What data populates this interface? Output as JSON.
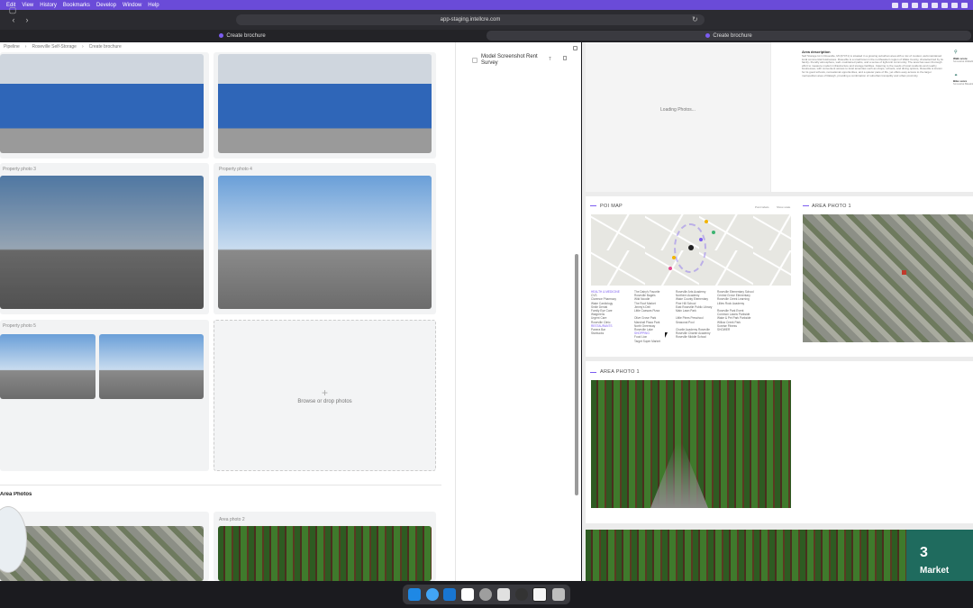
{
  "menubar": {
    "items": [
      "Edit",
      "View",
      "History",
      "Bookmarks",
      "Develop",
      "Window",
      "Help"
    ]
  },
  "browser": {
    "url": "app-staging.intellcre.com",
    "tabs": [
      {
        "label": "Create brochure",
        "active": false
      },
      {
        "label": "Create brochure",
        "active": true
      }
    ]
  },
  "breadcrumb": [
    "Pipeline",
    "Roseville Self-Storage",
    "Create brochure"
  ],
  "photos": {
    "property_photo_3_label": "Property photo 3",
    "property_photo_4_label": "Property photo 4",
    "property_photo_5_label": "Property photo 5",
    "dropzone_label": "Browse or drop photos",
    "area_section_title": "Area Photos",
    "area_photo_2_label": "Area photo 2"
  },
  "survey": {
    "title": "Model Screenshot Rent Survey",
    "sort_icon_label": "T"
  },
  "preview": {
    "loading_text": "Loading Photos...",
    "area_description_title": "Area description",
    "area_description_text": "Self Storage lot in Roseville, MI (07471) is situated in a growing suburban area with a mix of modest, well-maintained local commercial businesses. Roseville is a small town in the northeastern region of Wake County, characterized by its family- friendly atmosphere, well- maintained parks, and a sense of tight-knit community. The area has seen thorough effort to measure modern infrastructure and storage facilities. Catering to the needs of local residents and nearby businesses, with convenient access to local amenities such as shops, schools, and dining options, Roseville is known for its good schools, recreational opportunities, and a quieter pace of life, yet offers easy access to the larger metropolitan area of Raleigh, providing a combination of suburban tranquility and urban proximity.",
    "walk_score_label": "Walk score",
    "walk_score_desc": "Somewhat Walkable",
    "bike_score_label": "Bike score",
    "bike_score_desc": "Somewhat Bikeable",
    "poi_map_title": "POI MAP",
    "area_photo_title": "AREA PHOTO 1",
    "area_photo_title_2": "AREA PHOTO 1",
    "poi_toggle_1": "Point labels",
    "poi_toggle_2": "Show scale",
    "market_number": "3",
    "market_label": "Market"
  },
  "poi": {
    "col1_head": "HEALTH & MEDICINE",
    "col1": [
      "CVS",
      "Clarence Pharmacy",
      "Wake Cardiology",
      "Smile Dental",
      "Family Eye Care",
      "Walgreens",
      "Urgent Care",
      "Roseville Clinic"
    ],
    "col1b_head": "RESTAURANTS",
    "col1b": [
      "Panera Bar",
      "Starbucks"
    ],
    "col2": [
      "The Dairy's Favorite",
      "Roseville Bagels",
      "Wild Noodle",
      "The Roof Market",
      "Jimmy's Deli",
      "Little Caesars Pizza"
    ],
    "col2b": [
      "Olive Grove Park",
      "Marshall Plaza Park",
      "North Greenway",
      "Roseville Lake"
    ],
    "col2c_head": "SHOPPING",
    "col2c": [
      "Food Lion",
      "Target Super Market"
    ],
    "col3": [
      "Roseville Arts Academy",
      "Northern Academy",
      "Wake County Elementary",
      "Pine Hill School",
      "East Roseville Public Library",
      "Main Lawn Park"
    ],
    "col3b": [
      "Little Pines Preschool",
      "Seasonal Pool"
    ],
    "col3c": [
      "Charlie Academy Roseville",
      "Roseville Charter Academy",
      "Roseville Middle School"
    ],
    "col4": [
      "Roseville Elementary School",
      "Central Grove Elementary",
      "Roseville Creek Learning",
      "Lillies Rock Academy"
    ],
    "col4b": [
      "Roseville Park Event",
      "Common Lawns Parkside",
      "Wake & Pet Park Parkside",
      "Willow Creek Park",
      "Sunrise Fitness",
      "SHOWER"
    ]
  },
  "colors": {
    "accent": "#7b5cf0",
    "menubar": "#6a4bd8",
    "market_panel": "#1f6b5e"
  }
}
